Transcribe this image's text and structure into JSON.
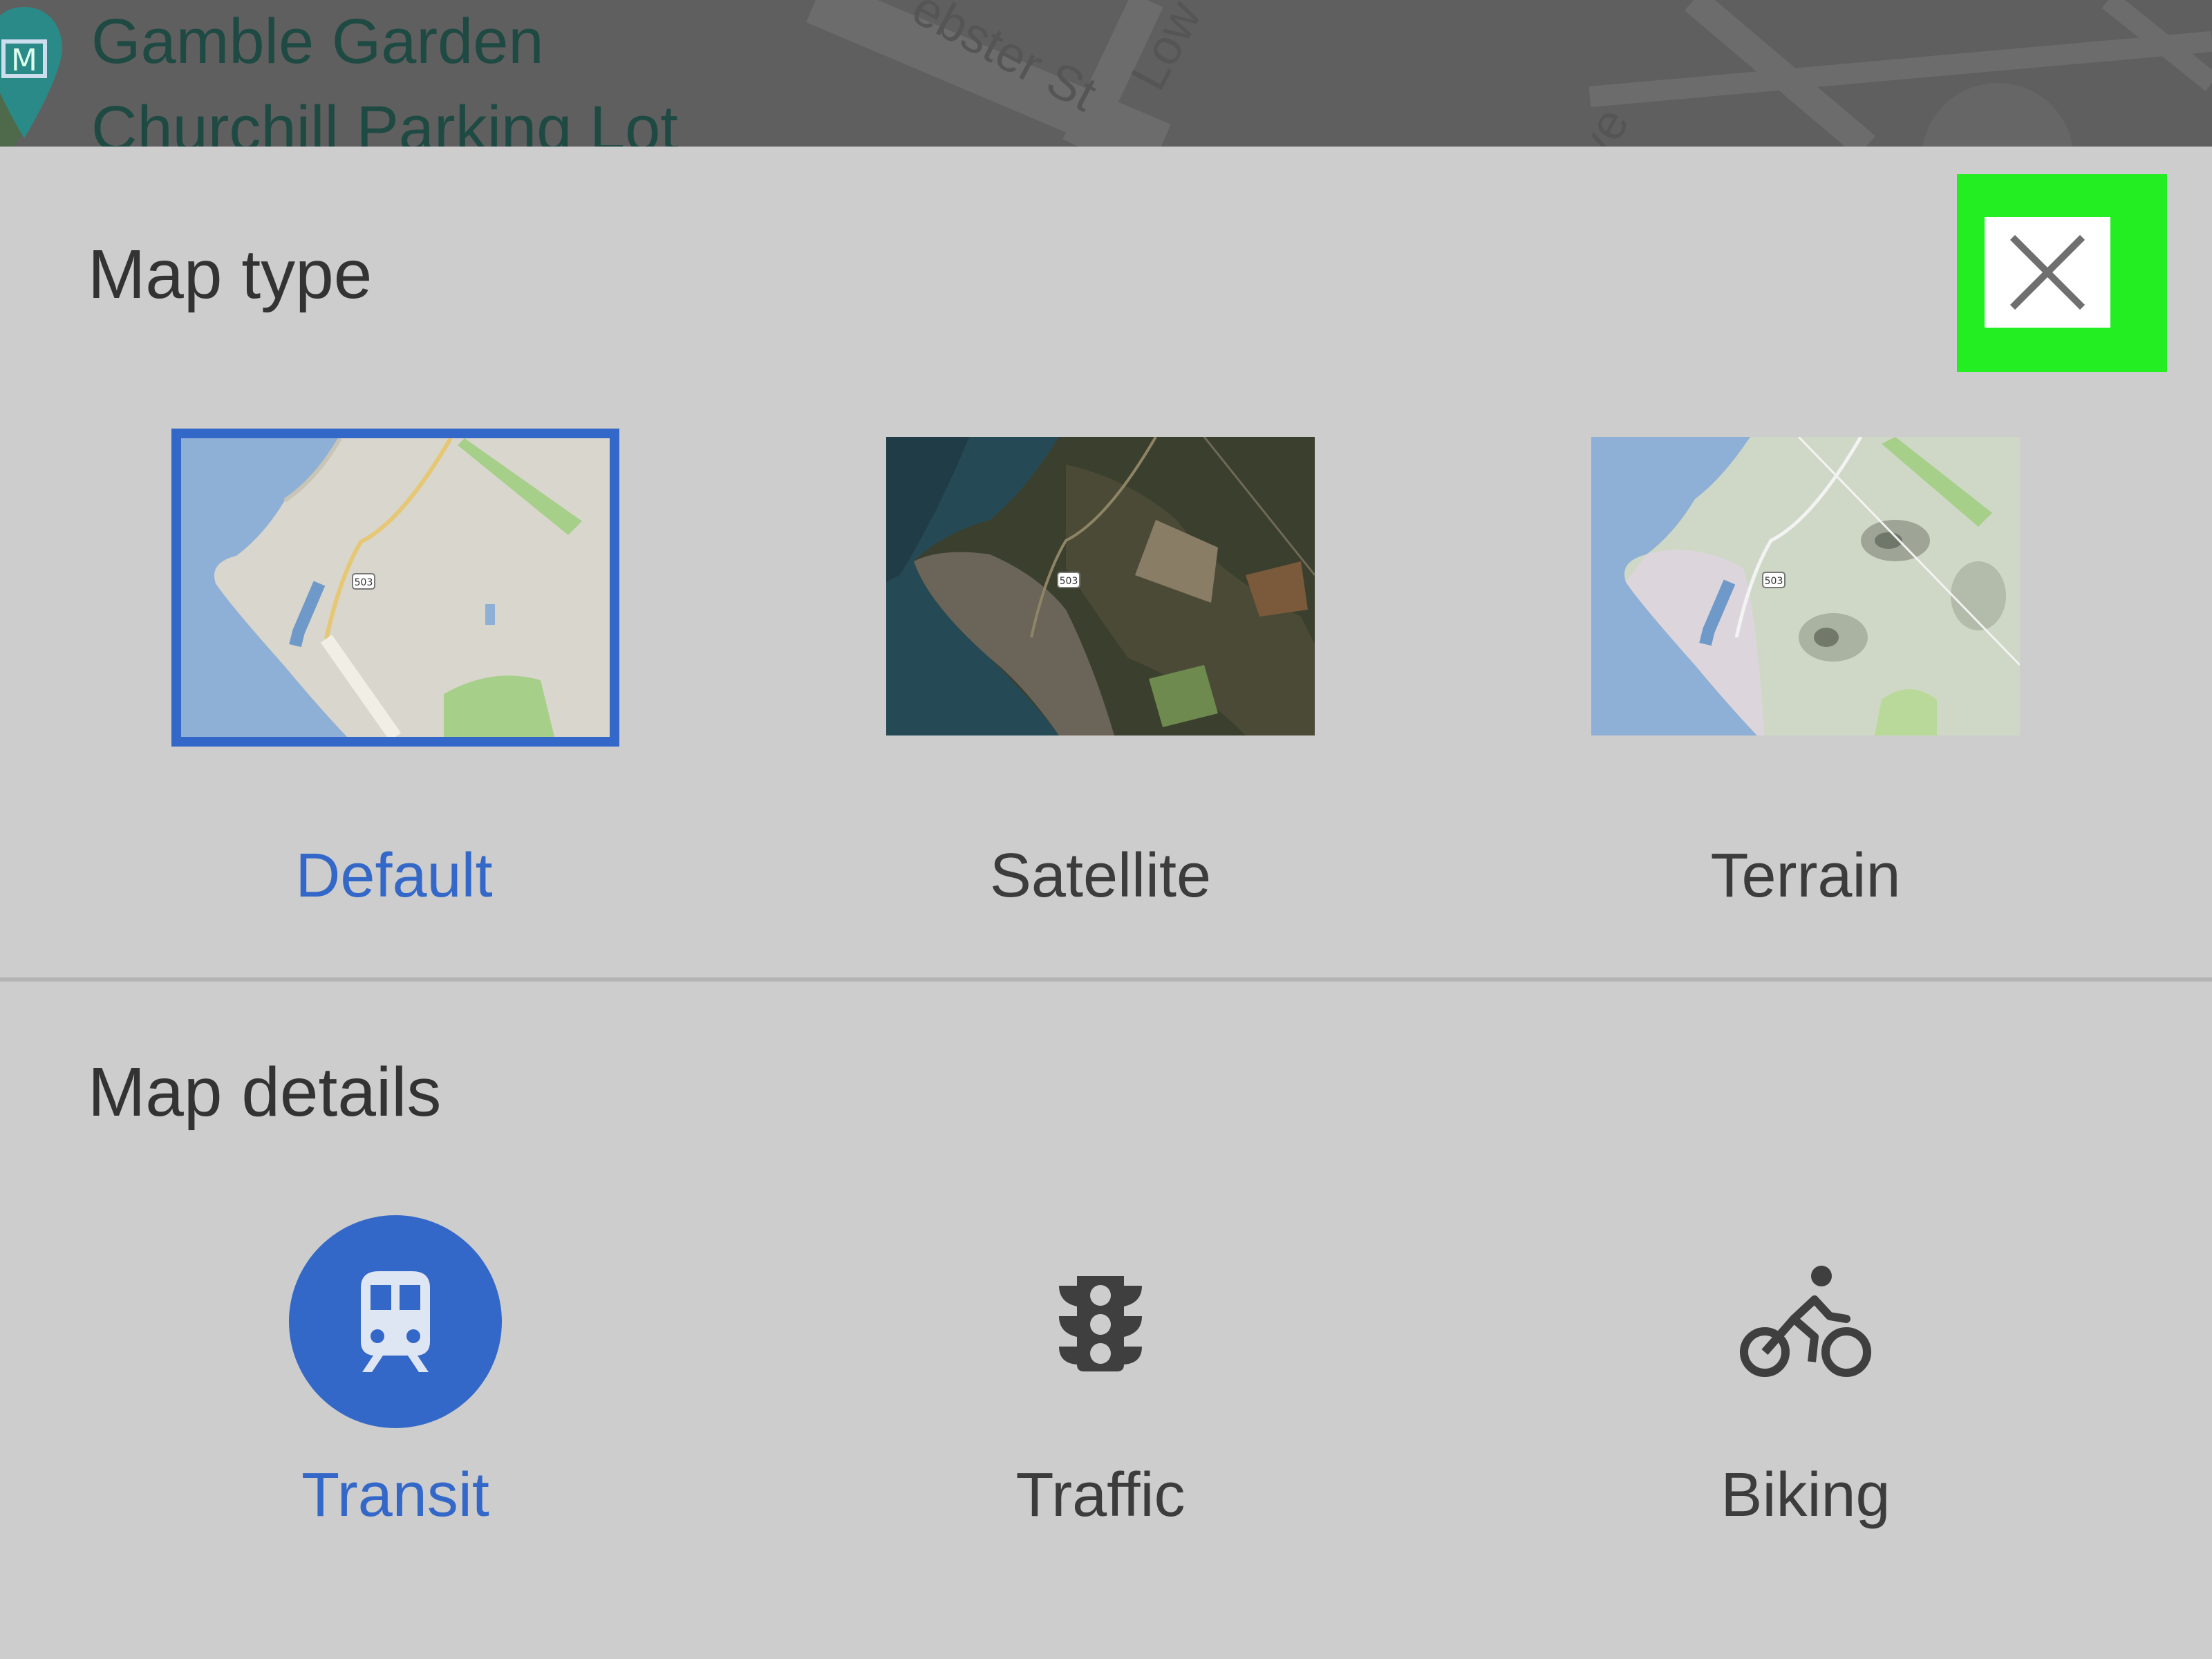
{
  "background_map": {
    "poi_icon": "museum-pin-icon",
    "poi_line1": "Gamble Garden",
    "poi_line2": "Churchill Parking Lot",
    "street_1": "ebster St",
    "street_2": "Low",
    "street_3": "ve"
  },
  "map_type": {
    "title": "Map type",
    "close_icon": "close-icon",
    "options": [
      {
        "label": "Default",
        "selected": true,
        "thumb": "default-map-thumbnail",
        "route_badge": "503"
      },
      {
        "label": "Satellite",
        "selected": false,
        "thumb": "satellite-map-thumbnail",
        "route_badge": "503"
      },
      {
        "label": "Terrain",
        "selected": false,
        "thumb": "terrain-map-thumbnail",
        "route_badge": "503"
      }
    ]
  },
  "map_details": {
    "title": "Map details",
    "options": [
      {
        "label": "Transit",
        "active": true,
        "icon": "train-icon"
      },
      {
        "label": "Traffic",
        "active": false,
        "icon": "traffic-light-icon"
      },
      {
        "label": "Biking",
        "active": false,
        "icon": "bicycle-icon"
      }
    ]
  },
  "colors": {
    "accent": "#3468c8",
    "sheet_background": "#cdcdcd",
    "highlight": "#22ee22",
    "text": "#3c3c3c"
  }
}
